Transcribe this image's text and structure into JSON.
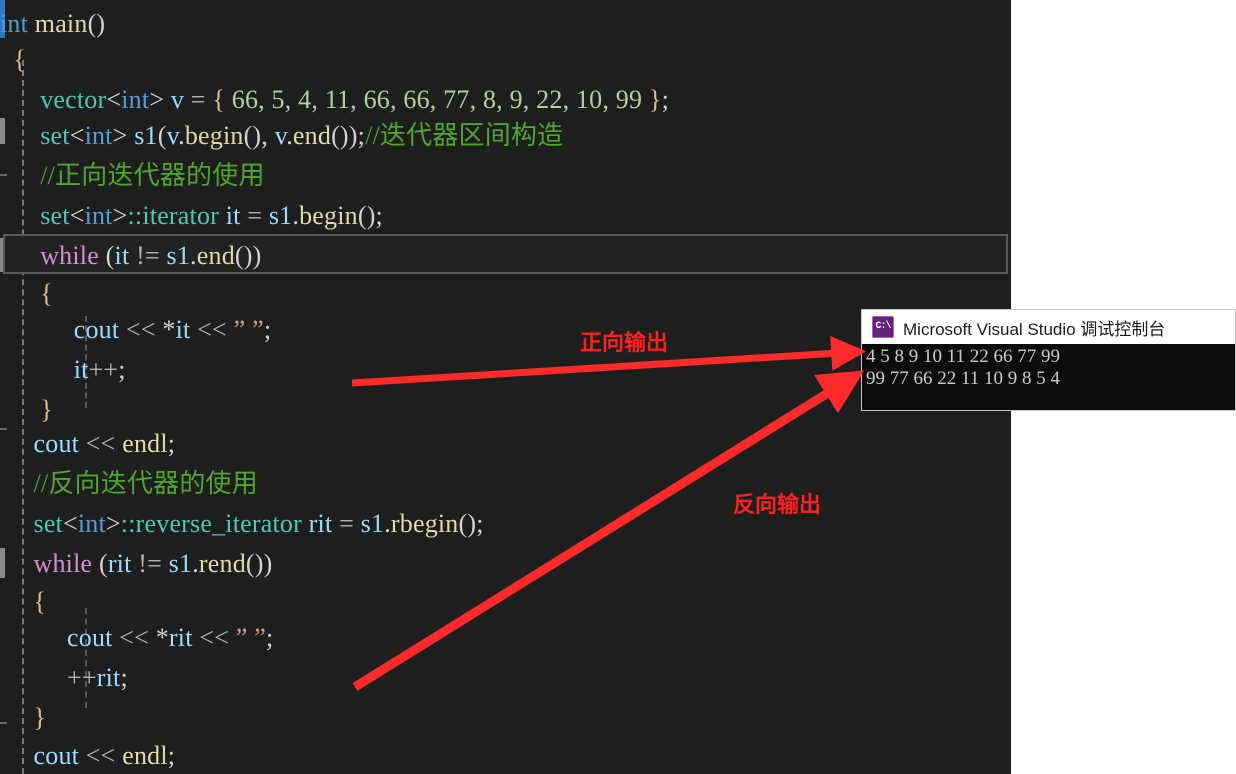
{
  "editor": {
    "theme_bg": "#1e1e1e",
    "current_line_index": 6,
    "lines": [
      {
        "indent": 0,
        "text": "int main()"
      },
      {
        "indent": 0,
        "text": "{"
      },
      {
        "indent": 1,
        "text": "vector<int> v = { 66, 5, 4, 11, 66, 66, 77, 8, 9, 22, 10, 99 };"
      },
      {
        "indent": 1,
        "text": "set<int> s1(v.begin(), v.end());//迭代器区间构造"
      },
      {
        "indent": 1,
        "text": "//正向迭代器的使用"
      },
      {
        "indent": 1,
        "text": "set<int>::iterator it = s1.begin();"
      },
      {
        "indent": 1,
        "text": "while (it != s1.end())"
      },
      {
        "indent": 1,
        "text": "{"
      },
      {
        "indent": 2,
        "text": "cout << *it << ” ”;"
      },
      {
        "indent": 2,
        "text": "it++;"
      },
      {
        "indent": 1,
        "text": "}"
      },
      {
        "indent": 1,
        "text": "cout << endl;"
      },
      {
        "indent": 1,
        "text": "//反向迭代器的使用"
      },
      {
        "indent": 1,
        "text": "set<int>::reverse_iterator rit = s1.rbegin();"
      },
      {
        "indent": 1,
        "text": "while (rit != s1.rend())"
      },
      {
        "indent": 1,
        "text": "{"
      },
      {
        "indent": 2,
        "text": "cout << *rit << ” ”;"
      },
      {
        "indent": 2,
        "text": "++rit;"
      },
      {
        "indent": 1,
        "text": "}"
      },
      {
        "indent": 1,
        "text": "cout << endl;"
      }
    ],
    "colors": {
      "keyword": "#d291d2",
      "type": "#4ec9b0",
      "builtin_type": "#569cd6",
      "variable": "#9cdcfe",
      "function": "#dcdcaa",
      "number": "#b5cea8",
      "comment": "#4ea72e",
      "string": "#d69d85",
      "punctuation": "#d4d4d4"
    }
  },
  "console": {
    "title": "Microsoft Visual Studio 调试控制台",
    "icon": "console-app-icon",
    "icon_color": "#68217a",
    "output_lines": [
      "4 5 8 9 10 11 22 66 77 99",
      "99 77 66 22 11 10 9 8 5 4"
    ]
  },
  "annotations": {
    "color": "#ff2020",
    "forward_label": "正向输出",
    "reverse_label": "反向输出"
  }
}
